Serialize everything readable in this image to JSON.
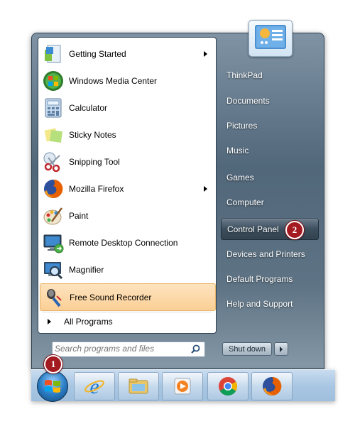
{
  "start_menu": {
    "programs": [
      {
        "label": "Getting Started",
        "icon": "getting-started-icon",
        "has_submenu": true
      },
      {
        "label": "Windows Media Center",
        "icon": "windows-media-center-icon",
        "has_submenu": false
      },
      {
        "label": "Calculator",
        "icon": "calculator-icon",
        "has_submenu": false
      },
      {
        "label": "Sticky Notes",
        "icon": "sticky-notes-icon",
        "has_submenu": false
      },
      {
        "label": "Snipping Tool",
        "icon": "snipping-tool-icon",
        "has_submenu": false
      },
      {
        "label": "Mozilla Firefox",
        "icon": "firefox-icon",
        "has_submenu": true
      },
      {
        "label": "Paint",
        "icon": "paint-icon",
        "has_submenu": false
      },
      {
        "label": "Remote Desktop Connection",
        "icon": "remote-desktop-icon",
        "has_submenu": false
      },
      {
        "label": "Magnifier",
        "icon": "magnifier-icon",
        "has_submenu": false
      },
      {
        "label": "Free Sound Recorder",
        "icon": "microphone-icon",
        "has_submenu": false,
        "highlighted": true
      }
    ],
    "all_programs": "All Programs",
    "search_placeholder": "Search programs and files",
    "right_items": [
      {
        "label": "ThinkPad"
      },
      {
        "label": "Documents"
      },
      {
        "label": "Pictures"
      },
      {
        "label": "Music"
      },
      {
        "label": "Games"
      },
      {
        "label": "Computer"
      },
      {
        "label": "Control Panel",
        "highlighted": true
      },
      {
        "label": "Devices and Printers"
      },
      {
        "label": "Default Programs"
      },
      {
        "label": "Help and Support"
      }
    ],
    "shutdown": "Shut down"
  },
  "taskbar": {
    "pinned": [
      "internet-explorer-icon",
      "windows-explorer-icon",
      "media-player-icon",
      "chrome-icon",
      "firefox-icon"
    ]
  },
  "callouts": {
    "one": "1",
    "two": "2"
  },
  "colors": {
    "highlight": "#fbcf95",
    "badge": "#a31b21",
    "taskbar": "#a9c7e3"
  }
}
